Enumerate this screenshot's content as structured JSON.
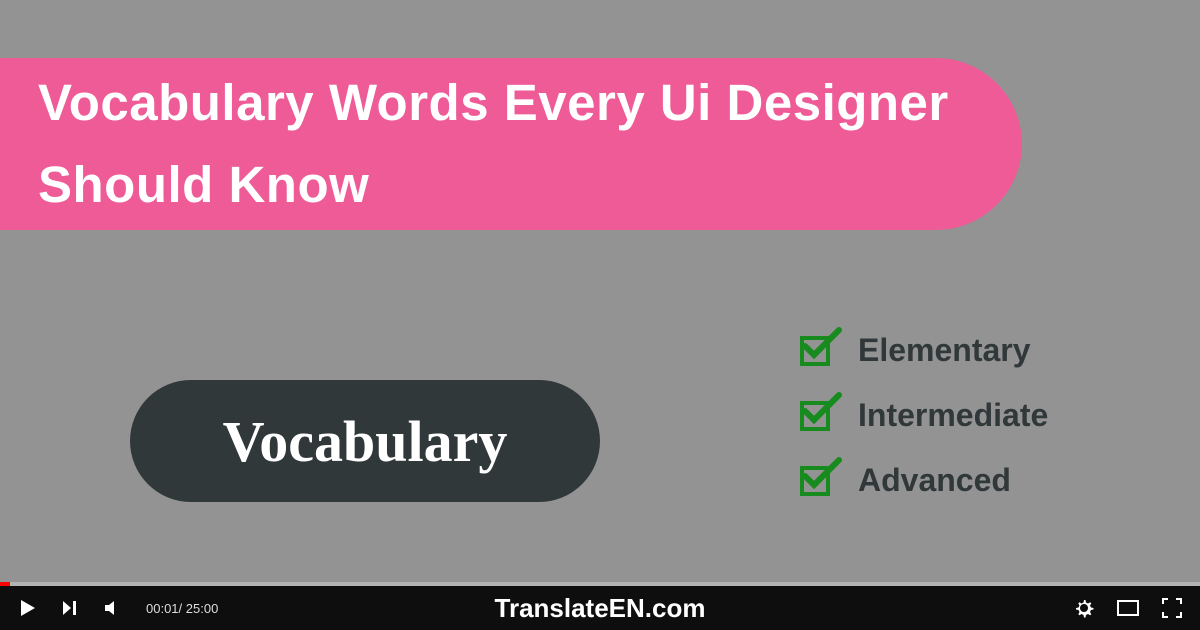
{
  "title": "Vocabulary Words Every Ui Designer Should Know",
  "vocab_label": "Vocabulary",
  "levels": [
    {
      "label": "Elementary"
    },
    {
      "label": "Intermediate"
    },
    {
      "label": "Advanced"
    }
  ],
  "player": {
    "current_time": "00:01",
    "total_time": "25:00",
    "brand": "TranslateEN.com"
  }
}
